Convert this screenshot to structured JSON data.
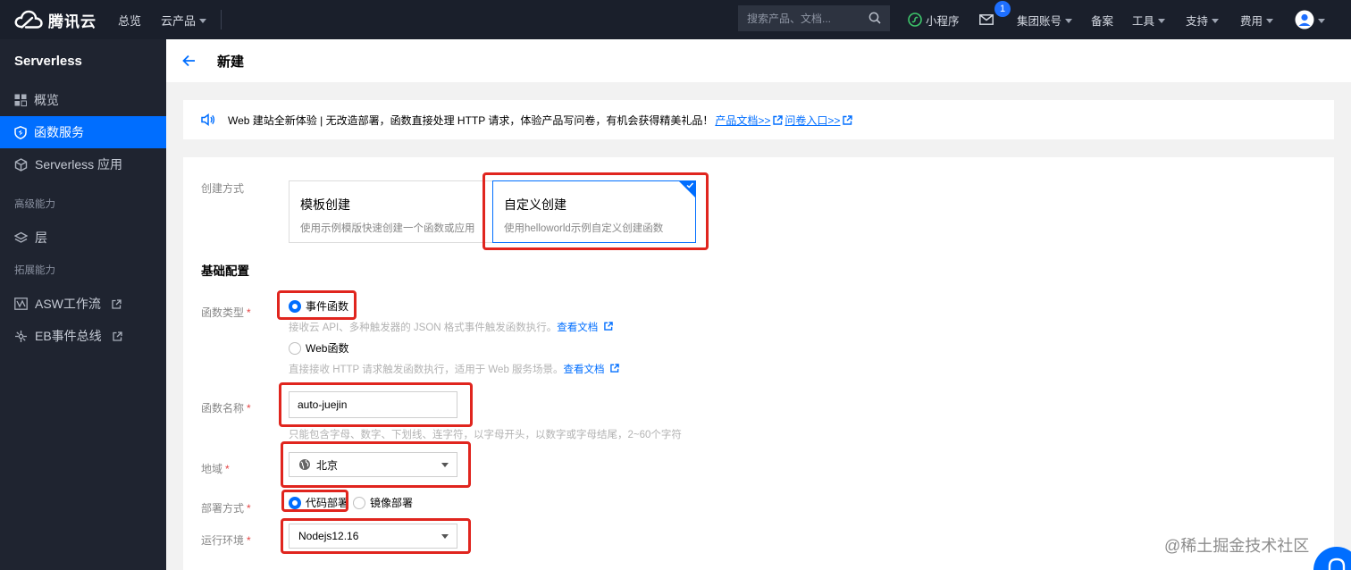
{
  "topbar": {
    "brand": "腾讯云",
    "nav": [
      {
        "label": "总览",
        "dropdown": false
      },
      {
        "label": "云产品",
        "dropdown": true
      }
    ],
    "search_placeholder": "搜索产品、文档...",
    "mini_program": "小程序",
    "mail_badge": "1",
    "right_menu": [
      {
        "label": "集团账号",
        "dropdown": true
      },
      {
        "label": "备案",
        "dropdown": false
      },
      {
        "label": "工具",
        "dropdown": true
      },
      {
        "label": "支持",
        "dropdown": true
      },
      {
        "label": "费用",
        "dropdown": true
      }
    ]
  },
  "sidebar": {
    "title": "Serverless",
    "items": [
      {
        "label": "概览",
        "icon": "grid-icon"
      },
      {
        "label": "函数服务",
        "icon": "shield-icon",
        "active": true
      },
      {
        "label": "Serverless 应用",
        "icon": "cube-icon"
      }
    ],
    "section_advanced": "高级能力",
    "advanced_items": [
      {
        "label": "层",
        "icon": "layers-icon"
      }
    ],
    "section_extend": "拓展能力",
    "extend_items": [
      {
        "label": "ASW工作流",
        "icon": "workflow-icon",
        "external": true
      },
      {
        "label": "EB事件总线",
        "icon": "eventbus-icon",
        "external": true
      }
    ]
  },
  "header": {
    "title": "新建"
  },
  "notice": {
    "text": "Web 建站全新体验 | 无改造部署，函数直接处理 HTTP 请求，体验产品写问卷，有机会获得精美礼品！",
    "link1": "产品文档>>",
    "link2": "问卷入口>>"
  },
  "form": {
    "create_method_label": "创建方式",
    "template_card": {
      "title": "模板创建",
      "desc": "使用示例模版快速创建一个函数或应用"
    },
    "custom_card": {
      "title": "自定义创建",
      "desc": "使用helloworld示例自定义创建函数"
    },
    "section_basic": "基础配置",
    "func_type_label": "函数类型",
    "func_type_options": [
      {
        "label": "事件函数",
        "selected": true,
        "help": "接收云 API、多种触发器的 JSON 格式事件触发函数执行。",
        "help_link": "查看文档"
      },
      {
        "label": "Web函数",
        "selected": false,
        "help": "直接接收 HTTP 请求触发函数执行，适用于 Web 服务场景。",
        "help_link": "查看文档"
      }
    ],
    "func_name_label": "函数名称",
    "func_name_value": "auto-juejin",
    "func_name_help": "只能包含字母、数字、下划线、连字符，以字母开头，以数字或字母结尾，2~60个字符",
    "region_label": "地域",
    "region_value": "北京",
    "deploy_label": "部署方式",
    "deploy_options": [
      {
        "label": "代码部署",
        "selected": true
      },
      {
        "label": "镜像部署",
        "selected": false
      }
    ],
    "runtime_label": "运行环境",
    "runtime_value": "Nodejs12.16"
  },
  "watermark": "@稀土掘金技术社区",
  "colors": {
    "accent": "#006eff",
    "topbar": "#1a1f2b",
    "sidebar": "#1f2430",
    "highlight": "#e0251e"
  }
}
